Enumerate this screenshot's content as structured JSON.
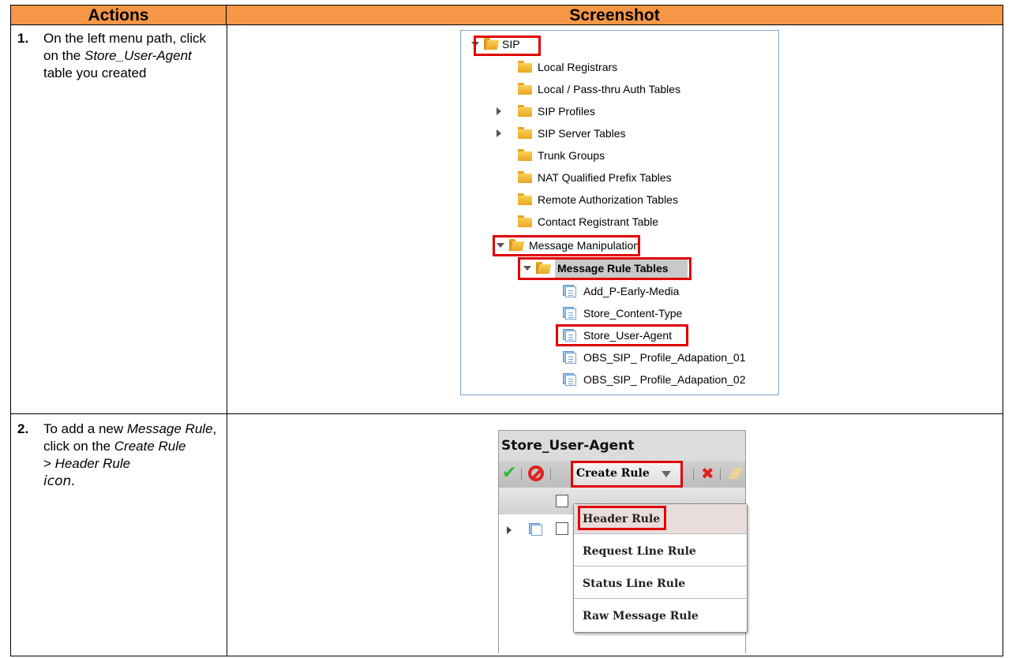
{
  "table": {
    "header_actions": "Actions",
    "header_screenshot": "Screenshot"
  },
  "steps": [
    {
      "number": "1.",
      "text_parts": [
        "On the left menu path, click on the ",
        "Store_User-Agent",
        " table you created"
      ]
    },
    {
      "number": "2.",
      "text_parts": [
        "To add a new ",
        "Message Rule",
        ", click on the ",
        "Create Rule",
        " > ",
        "Header Rule",
        " ",
        "icon."
      ]
    }
  ],
  "tree": {
    "root": "SIP",
    "items": [
      "Local Registrars",
      "Local / Pass-thru Auth Tables",
      "SIP Profiles",
      "SIP Server Tables",
      "Trunk Groups",
      "NAT Qualified Prefix Tables",
      "Remote Authorization Tables",
      "Contact Registrant Table",
      "Message Manipulation",
      "Message Rule Tables"
    ],
    "tables": [
      "Add_P-Early-Media",
      "Store_Content-Type",
      "Store_User-Agent",
      "OBS_SIP_ Profile_Adapation_01",
      "OBS_SIP_ Profile_Adapation_02"
    ]
  },
  "rule_screen": {
    "title": "Store_User-Agent",
    "create_button": "Create Rule",
    "menu_items": [
      "Header Rule",
      "Request Line Rule",
      "Status Line Rule",
      "Raw Message Rule"
    ]
  },
  "colors": {
    "header_bg": "#f79646",
    "highlight_red": "#e00000"
  }
}
